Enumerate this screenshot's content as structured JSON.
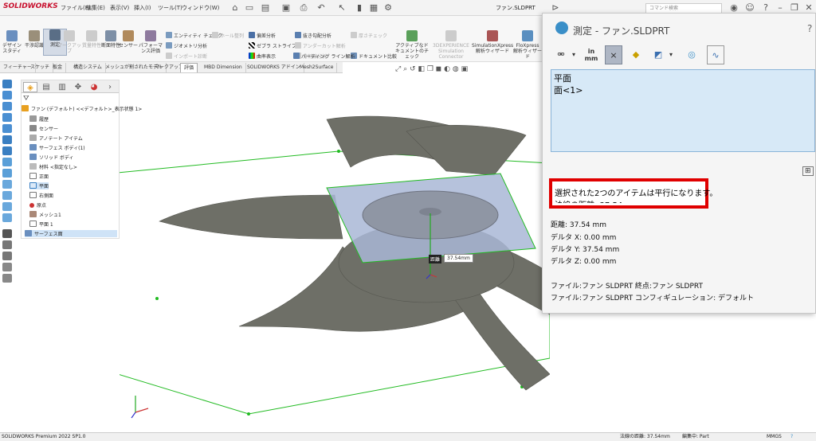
{
  "app": {
    "brand": "SOLIDWORKS",
    "document_title": "ファン.SLDPRT",
    "search_placeholder": "コマンド検索"
  },
  "menus": [
    "ファイル(F)",
    "編集(E)",
    "表示(V)",
    "挿入(I)",
    "ツール(T)",
    "ウィンドウ(W)"
  ],
  "ribbon": {
    "buttons": [
      {
        "label": "デザイン スタディ"
      },
      {
        "label": "干渉認識"
      },
      {
        "label": "測定"
      },
      {
        "label": "マークアップ"
      },
      {
        "label": "質量特性"
      },
      {
        "label": "断面特性"
      },
      {
        "label": "センサー"
      },
      {
        "label": "パフォーマンス評価"
      }
    ],
    "small_items": [
      {
        "label": "エンティティ チェック"
      },
      {
        "label": "ジオメトリ分析"
      },
      {
        "label": "インポート診断"
      },
      {
        "label": "ホール整列"
      },
      {
        "label": "偏差分析"
      },
      {
        "label": "ゼブラ ストライプ"
      },
      {
        "label": "曲率表示"
      },
      {
        "label": "抜き勾配分析"
      },
      {
        "label": "アンダーカット解析"
      },
      {
        "label": "分割線分析"
      },
      {
        "label": "パーティング ライン解析"
      },
      {
        "label": "厚さチェック"
      },
      {
        "label": "ドキュメント比較"
      },
      {
        "label": "アクティブなドキュメントのチェック"
      }
    ],
    "right_buttons": [
      {
        "label": "3DEXPERIENCE Simulation Connector"
      },
      {
        "label": "SimulationXpress 解析ウィザード"
      },
      {
        "label": "FloXpress 解析ウィザード"
      }
    ]
  },
  "command_tabs": [
    "フィーチャー",
    "スケッチ",
    "板金",
    "構造システム",
    "メッシュが割されたモデル",
    "マークアップ",
    "評価",
    "MBD Dimension",
    "SOLIDWORKS アドイン",
    "Mesh2Surface"
  ],
  "feature_tree": [
    {
      "label": "ファン (デフォルト) <<デフォルト>_表示状態 1>",
      "icon": "part-icon"
    },
    {
      "label": "履歴",
      "icon": "history-icon"
    },
    {
      "label": "センサー",
      "icon": "sensor-icon"
    },
    {
      "label": "アノテート アイテム",
      "icon": "annotation-icon"
    },
    {
      "label": "サーフェス ボディ(1)",
      "icon": "surface-icon"
    },
    {
      "label": "ソリッド ボディ",
      "icon": "solid-icon"
    },
    {
      "label": "材料 <指定なし>",
      "icon": "material-icon"
    },
    {
      "label": "正面",
      "icon": "plane-icon"
    },
    {
      "label": "平面",
      "icon": "plane-icon"
    },
    {
      "label": "右側面",
      "icon": "plane-icon"
    },
    {
      "label": "原点",
      "icon": "origin-icon"
    },
    {
      "label": "メッシュ1",
      "icon": "mesh-icon"
    },
    {
      "label": "平面 1",
      "icon": "plane-icon"
    },
    {
      "label": "サーフェス面",
      "icon": "surface-icon"
    }
  ],
  "measure": {
    "title": "測定 - ファン.SLDPRT",
    "help": "?",
    "units_label": "in",
    "units_label2": "mm",
    "selections": [
      "平面",
      "面<1>"
    ],
    "highlight": "選択された2つのアイテムは平行になります。",
    "highlight_partial": "法線の距離: 37.54 mm",
    "results": [
      "距離: 37.54 mm",
      "デルタ X: 0.00 mm",
      "デルタ Y: 37.54 mm",
      "デルタ Z: 0.00 mm"
    ],
    "files": [
      "ファイル:ファン SLDPRT 終点:ファン SLDPRT",
      "ファイル:ファン SLDPRT コンフィギュレーション: デフォルト"
    ]
  },
  "viewport": {
    "dim_tag": "距離",
    "dim_value": "37.54mm"
  },
  "statusbar": {
    "left": "SOLIDWORKS Premium 2022 SP1.0",
    "normal_distance": "法線の距離: 37.54mm",
    "edit": "編集中: Part",
    "units": "MMGS"
  },
  "colors": {
    "accent_red": "#e00000",
    "plane_green": "#22bb22",
    "fan_gray": "#6e6f67",
    "selection_blue": "#d7e9f7"
  }
}
